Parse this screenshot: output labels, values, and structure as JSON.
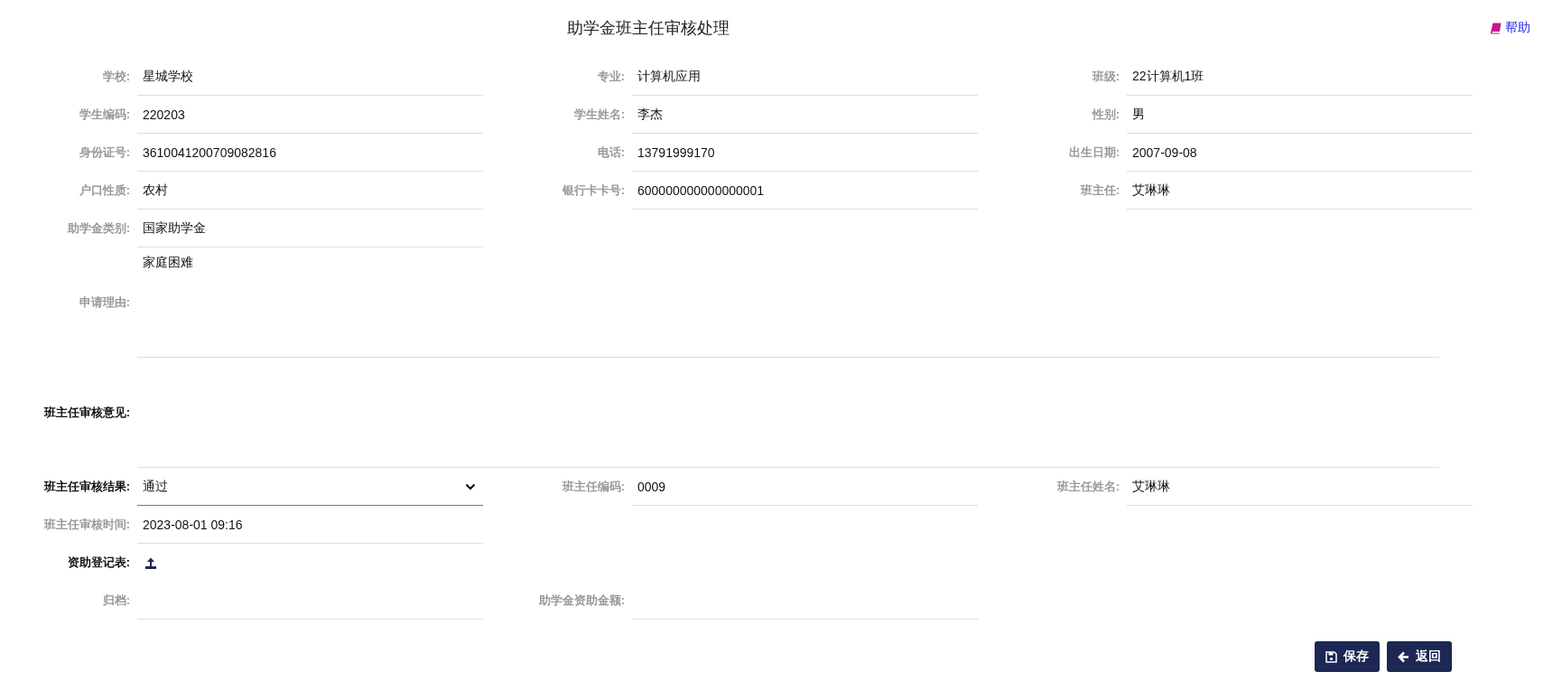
{
  "title": "助学金班主任审核处理",
  "help": {
    "label": "帮助"
  },
  "rows": [
    {
      "kind": "fields",
      "fields": [
        {
          "kind": "text",
          "label": "学校:",
          "value": "星城学校",
          "required": false
        },
        {
          "kind": "text",
          "label": "专业:",
          "value": "计算机应用",
          "required": false
        },
        {
          "kind": "text",
          "label": "班级:",
          "value": "22计算机1班",
          "required": false
        }
      ]
    },
    {
      "kind": "fields",
      "fields": [
        {
          "kind": "text",
          "label": "学生编码:",
          "value": "220203",
          "required": false
        },
        {
          "kind": "text",
          "label": "学生姓名:",
          "value": "李杰",
          "required": false
        },
        {
          "kind": "text",
          "label": "性别:",
          "value": "男",
          "required": false
        }
      ]
    },
    {
      "kind": "fields",
      "fields": [
        {
          "kind": "text",
          "label": "身份证号:",
          "value": "3610041200709082816",
          "required": false
        },
        {
          "kind": "text",
          "label": "电话:",
          "value": "13791999170",
          "required": false
        },
        {
          "kind": "text",
          "label": "出生日期:",
          "value": "2007-09-08",
          "required": false
        }
      ]
    },
    {
      "kind": "fields",
      "fields": [
        {
          "kind": "text",
          "label": "户口性质:",
          "value": "农村",
          "required": false
        },
        {
          "kind": "text",
          "label": "银行卡卡号:",
          "value": "600000000000000001",
          "required": false
        },
        {
          "kind": "text",
          "label": "班主任:",
          "value": "艾琳琳",
          "required": false
        }
      ]
    },
    {
      "kind": "fields",
      "fields": [
        {
          "kind": "text",
          "label": "助学金类别:",
          "value": "国家助学金",
          "required": false
        }
      ]
    },
    {
      "kind": "textarea",
      "label": "申请理由:",
      "value": "家庭困难",
      "required": false
    },
    {
      "kind": "textarea",
      "label": "班主任审核意见:",
      "required": true
    },
    {
      "kind": "fields",
      "fields": [
        {
          "kind": "select",
          "label": "班主任审核结果:",
          "value": "通过",
          "required": true
        },
        {
          "kind": "text",
          "label": "班主任编码:",
          "value": "0009",
          "required": false
        },
        {
          "kind": "text",
          "label": "班主任姓名:",
          "value": "艾琳琳",
          "required": false
        }
      ]
    },
    {
      "kind": "fields",
      "fields": [
        {
          "kind": "text",
          "label": "班主任审核时间:",
          "value": "2023-08-01 09:16",
          "required": false
        }
      ]
    },
    {
      "kind": "fields",
      "fields": [
        {
          "kind": "upload",
          "label": "资助登记表:",
          "required": true
        }
      ]
    },
    {
      "kind": "fields",
      "fields": [
        {
          "kind": "text",
          "label": "归档:",
          "required": false
        },
        {
          "kind": "text",
          "label": "助学金资助金额:",
          "required": false
        }
      ]
    }
  ],
  "buttons": [
    {
      "kind": "save",
      "label": "保存"
    },
    {
      "kind": "back",
      "label": "返回"
    }
  ]
}
